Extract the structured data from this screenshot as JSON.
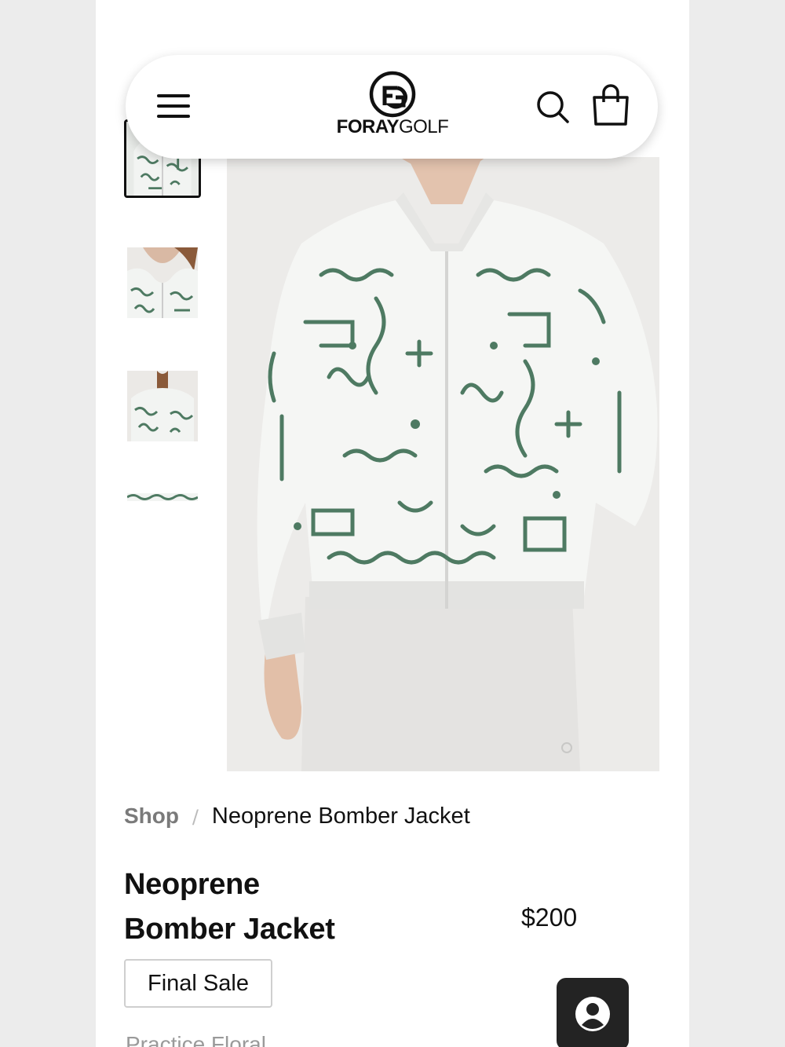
{
  "header": {
    "brand_strong": "FORAY",
    "brand_light": "GOLF",
    "menu_icon": "hamburger-menu-icon",
    "search_icon": "search-icon",
    "bag_icon": "shopping-bag-icon"
  },
  "gallery": {
    "thumbnails": [
      {
        "name": "front view",
        "active": true
      },
      {
        "name": "neckline detail",
        "active": false
      },
      {
        "name": "back view",
        "active": false
      },
      {
        "name": "fabric detail",
        "active": false
      }
    ],
    "pattern_color": "#4e7a62"
  },
  "breadcrumb": {
    "parent": "Shop",
    "separator": "/",
    "current": "Neoprene Bomber Jacket"
  },
  "product": {
    "title_line1": "Neoprene",
    "title_line2": "Bomber Jacket",
    "price": "$200",
    "badge": "Final Sale",
    "variant": "Practice Floral"
  },
  "chat": {
    "icon": "user-avatar-icon"
  }
}
